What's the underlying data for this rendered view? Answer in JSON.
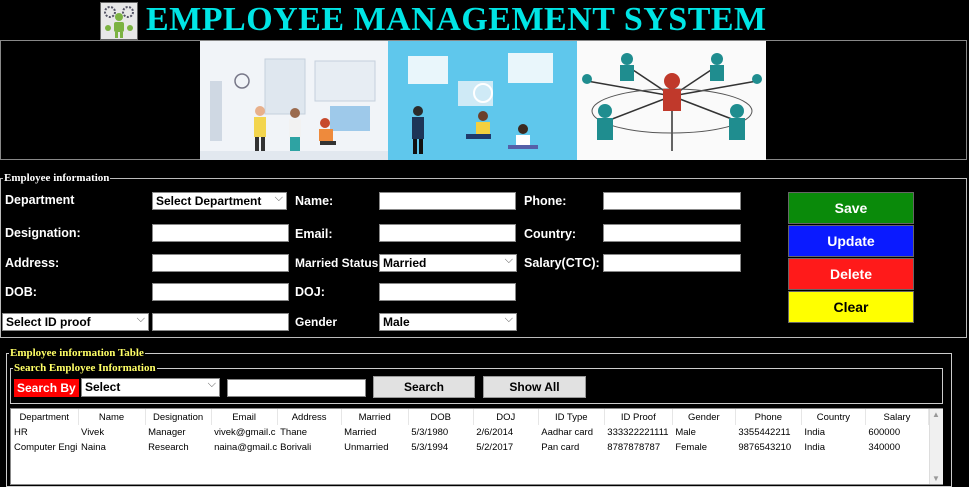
{
  "app": {
    "title": "EMPLOYEE MANAGEMENT SYSTEM",
    "logo_icon": "team-gear-icon"
  },
  "employee_info": {
    "legend": "Employee information",
    "labels": {
      "department": "Department",
      "designation": "Designation:",
      "address": "Address:",
      "dob": "DOB:",
      "name": "Name:",
      "email": "Email:",
      "married_status": "Married Status",
      "doj": "DOJ:",
      "gender": "Gender",
      "phone": "Phone:",
      "country": "Country:",
      "salary": "Salary(CTC):"
    },
    "values": {
      "department": "Select Department",
      "id_proof": "Select ID proof",
      "married_status": "Married",
      "gender": "Male",
      "designation": "",
      "address": "",
      "dob": "",
      "id_proof_number": "",
      "name": "",
      "email": "",
      "doj": "",
      "phone": "",
      "country": "",
      "salary": ""
    }
  },
  "actions": {
    "save": "Save",
    "update": "Update",
    "delete": "Delete",
    "clear": "Clear"
  },
  "table_section": {
    "legend": "Employee information Table",
    "search_legend": "Search Employee Information",
    "search_by": "Search By",
    "search_select": "Select",
    "search_text": "",
    "search_button": "Search",
    "show_all_button": "Show All"
  },
  "grid": {
    "columns": [
      "Department",
      "Name",
      "Designation",
      "Email",
      "Address",
      "Married",
      "DOB",
      "DOJ",
      "ID Type",
      "ID Proof",
      "Gender",
      "Phone",
      "Country",
      "Salary"
    ],
    "rows": [
      [
        "HR",
        "Vivek",
        "Manager",
        "vivek@gmail.c",
        "Thane",
        "Married",
        "5/3/1980",
        "2/6/2014",
        "Aadhar card",
        "333322221111",
        "Male",
        "3355442211",
        "India",
        "600000"
      ],
      [
        "Computer Engi",
        "Naina",
        "Research",
        "naina@gmail.c",
        "Borivali",
        "Unmarried",
        "5/3/1994",
        "5/2/2017",
        "Pan card",
        "8787878787",
        "Female",
        "9876543210",
        "India",
        "340000"
      ]
    ]
  },
  "colors": {
    "title": "#00e5e5",
    "legend": "#ffffff",
    "legend_table": "#ffff66",
    "save": "#0a8a0a",
    "update": "#0a1aff",
    "delete": "#ff1a1a",
    "clear": "#ffff00",
    "search_by": "#ff0000"
  }
}
